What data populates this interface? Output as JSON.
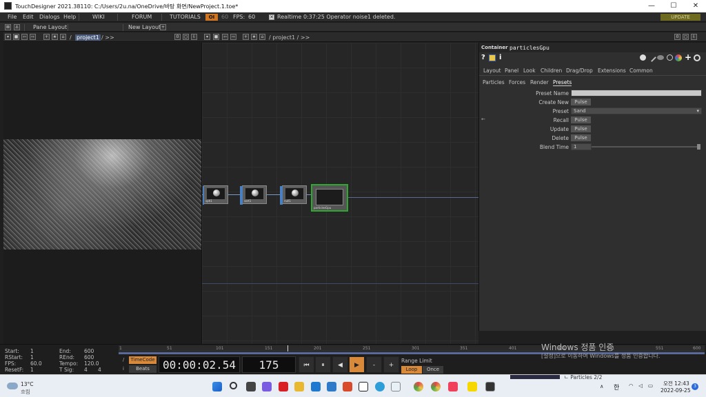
{
  "window": {
    "title": "TouchDesigner 2021.38110: C:/Users/2u.na/OneDrive/바탕 화면/NewProject.1.toe*",
    "controls": [
      "—",
      "☐",
      "✕"
    ]
  },
  "menubar": {
    "items": [
      "File",
      "Edit",
      "Dialogs",
      "Help"
    ],
    "links": [
      "WIKI",
      "FORUM",
      "TUTORIALS"
    ],
    "oi_label": "OI",
    "fps_dim": "60",
    "fps_label": "FPS:",
    "fps_value": "60",
    "realtime_label": "Realtime",
    "realtime_checked": "✕",
    "status": "0:37:25 Operator noise1 deleted.",
    "update_label": "UPDATE"
  },
  "panebar": {
    "pane_layout": "Pane Layout",
    "new_layout": "New Layout",
    "add": "+"
  },
  "left_pane": {
    "path_root": "/",
    "path_active": "project1",
    "path_rest": "/ >>",
    "counter": "0"
  },
  "right_pane": {
    "path": "/ project1 / >>",
    "counter": "0"
  },
  "network": {
    "nodes": [
      {
        "label": "sph1"
      },
      {
        "label": "sort1"
      },
      {
        "label": "null1"
      },
      {
        "label": "particlesGpu"
      }
    ]
  },
  "params": {
    "op_type": "Container",
    "op_name": "particlesGpu",
    "top_icons": [
      "?",
      "i"
    ],
    "tabs_row1": [
      "Layout",
      "Panel",
      "Look",
      "Children",
      "Drag/Drop",
      "Extensions",
      "Common"
    ],
    "tabs_row2": [
      "Particles",
      "Forces",
      "Render",
      "Presets"
    ],
    "active_tab": "Presets",
    "rows": [
      {
        "label": "Preset Name",
        "type": "field",
        "value": ""
      },
      {
        "label": "Create New",
        "type": "pulse",
        "value": "Pulse"
      },
      {
        "label": "Preset",
        "type": "menu",
        "value": "Sand"
      },
      {
        "label": "Recall",
        "type": "pulse",
        "value": "Pulse"
      },
      {
        "label": "Update",
        "type": "pulse",
        "value": "Pulse"
      },
      {
        "label": "Delete",
        "type": "pulse",
        "value": "Pulse"
      },
      {
        "label": "Blend Time",
        "type": "slider",
        "value": "1"
      }
    ]
  },
  "timeline": {
    "start_label": "Start:",
    "start": "1",
    "rstart_label": "RStart:",
    "rstart": "1",
    "fps_label": "FPS:",
    "fps": "60.0",
    "resetf_label": "ResetF:",
    "resetf": "1",
    "end_label": "End:",
    "end": "600",
    "rend_label": "REnd:",
    "rend": "600",
    "tempo_label": "Tempo:",
    "tempo": "120.0",
    "tsig_label": "T Sig:",
    "tsig_a": "4",
    "tsig_b": "4",
    "ticks": [
      "1",
      "51",
      "101",
      "151",
      "201",
      "251",
      "301",
      "351",
      "401",
      "451",
      "501",
      "551",
      "600"
    ],
    "timecode_btn": "TimeCode",
    "beats_btn": "Beats",
    "timecode": "00:00:02.54",
    "frame": "175",
    "transport": [
      "⏮",
      "⏸",
      "◀",
      "▶",
      "-",
      "+"
    ],
    "range_limit": "Range Limit",
    "loop": "Loop",
    "once": "Once"
  },
  "watermark": {
    "title": "Windows 정품 인증",
    "sub": "[설정]으로 이동하여 Windows를 정품 인증합니다."
  },
  "taskbar": {
    "weather_temp": "13°C",
    "weather_desc": "흐림",
    "clock_time": "오전 12:43",
    "clock_date": "2022-09-25",
    "lang": "한",
    "notif": "3",
    "preview_text": "ㄴ Particles 2/2"
  }
}
